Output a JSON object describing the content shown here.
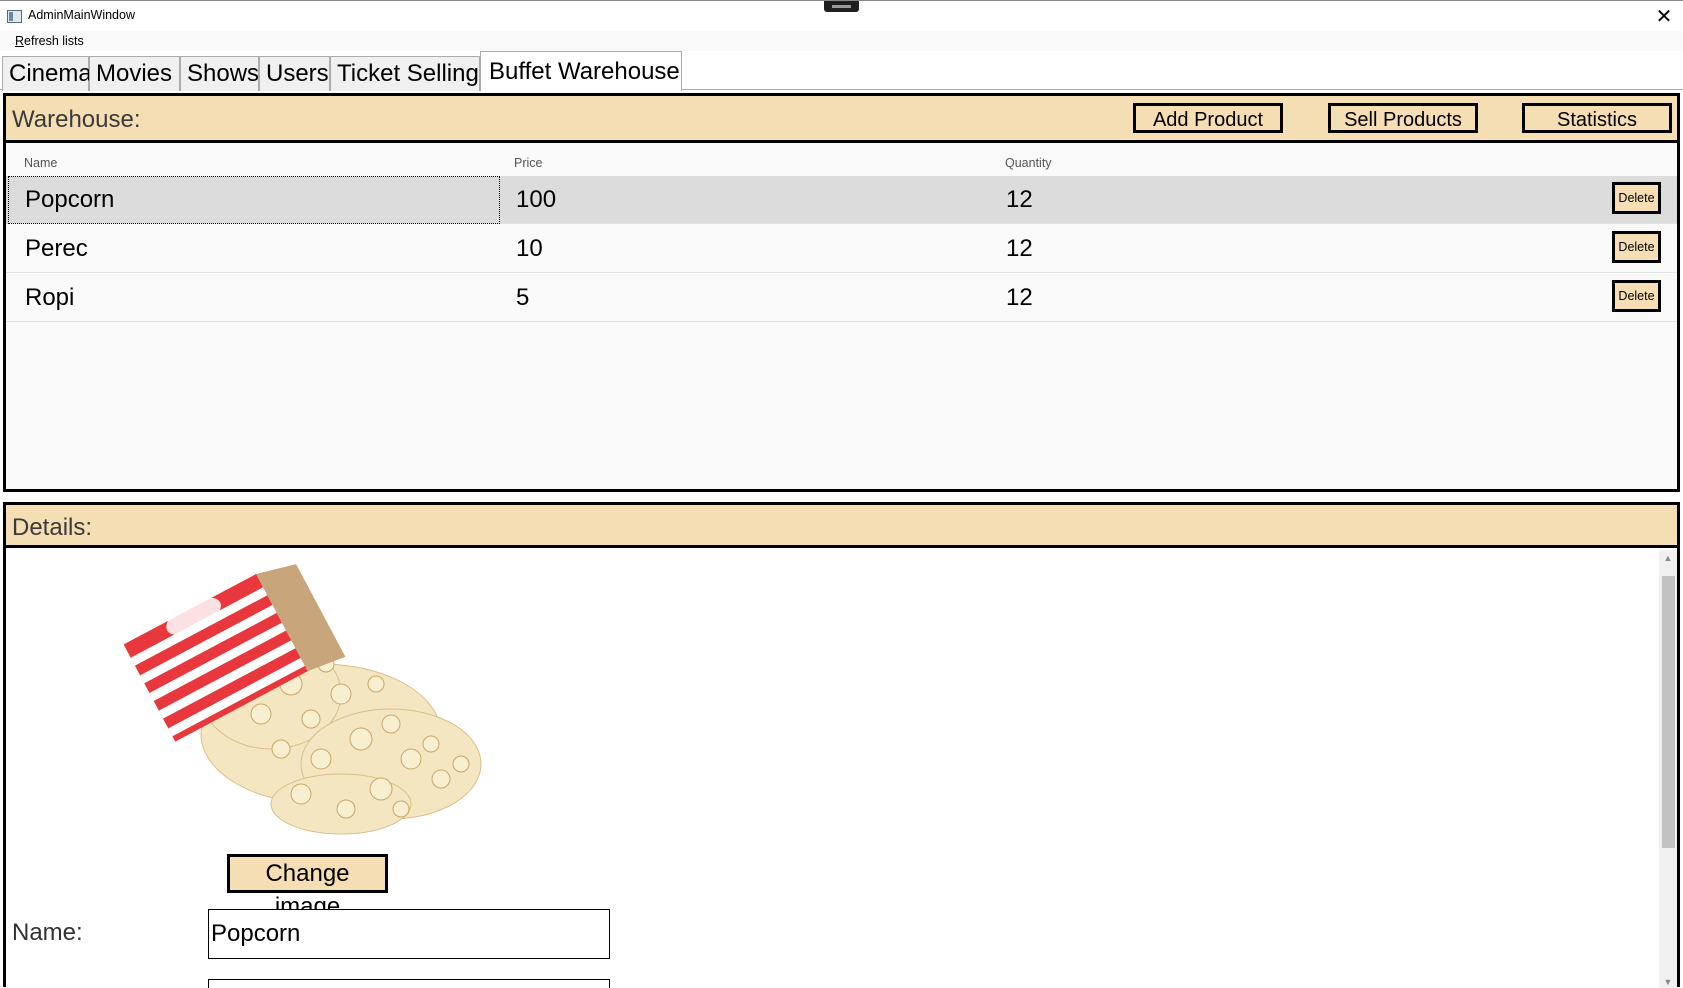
{
  "window": {
    "title": "AdminMainWindow",
    "close_glyph": "✕",
    "icon": "app-window-icon"
  },
  "menu": {
    "refresh_mnemonic": "R",
    "refresh_rest": "efresh lists"
  },
  "tabs": [
    {
      "label": "Cinema",
      "active": false
    },
    {
      "label": "Movies",
      "active": false
    },
    {
      "label": "Shows",
      "active": false
    },
    {
      "label": "Users",
      "active": false
    },
    {
      "label": "Ticket Selling",
      "active": false
    },
    {
      "label": "Buffet Warehouse",
      "active": true
    }
  ],
  "warehouse": {
    "title": "Warehouse:",
    "add_product_label": "Add Product",
    "sell_products_label": "Sell Products",
    "statistics_label": "Statistics",
    "columns": {
      "name": "Name",
      "price": "Price",
      "quantity": "Quantity"
    },
    "delete_label": "Delete",
    "rows": [
      {
        "name": "Popcorn",
        "price": "100",
        "quantity": "12",
        "selected": true
      },
      {
        "name": "Perec",
        "price": "10",
        "quantity": "12",
        "selected": false
      },
      {
        "name": "Ropi",
        "price": "5",
        "quantity": "12",
        "selected": false
      }
    ]
  },
  "details": {
    "title": "Details:",
    "image": "popcorn-image",
    "change_image_label": "Change image",
    "name_label": "Name:",
    "name_value": "Popcorn"
  },
  "colors": {
    "panel_header": "#f5deb3",
    "selected_row": "#dcdcdc",
    "border": "#000000"
  }
}
